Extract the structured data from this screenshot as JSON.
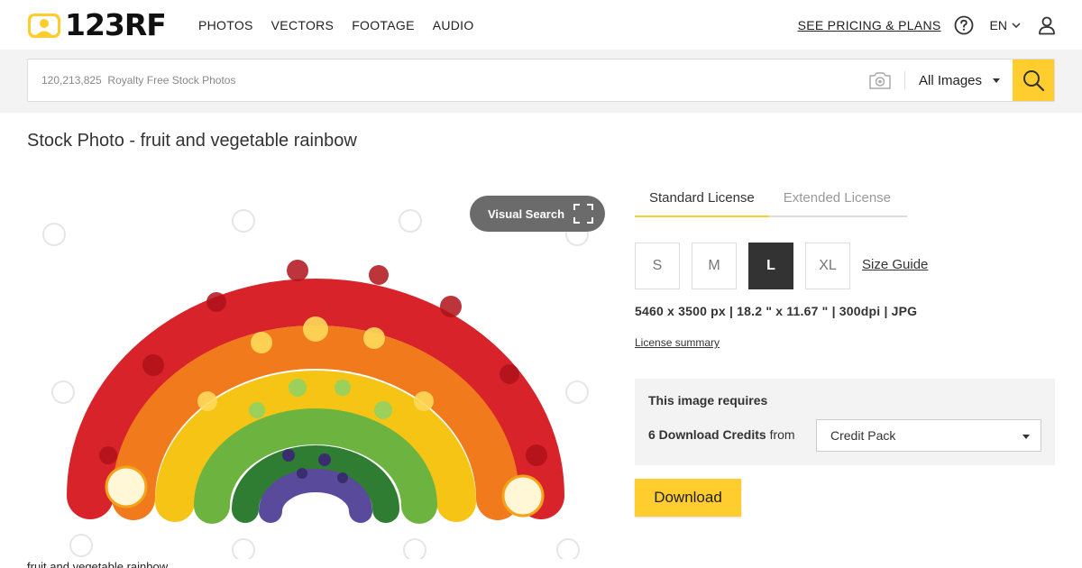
{
  "header": {
    "logo_text": "123RF",
    "nav": [
      "PHOTOS",
      "VECTORS",
      "FOOTAGE",
      "AUDIO"
    ],
    "pricing": "SEE PRICING & PLANS",
    "language": "EN"
  },
  "search": {
    "placeholder": "120,213,825  Royalty Free Stock Photos",
    "filter": "All Images"
  },
  "page": {
    "title": "Stock Photo - fruit and vegetable rainbow",
    "caption": "fruit and vegetable rainbow",
    "visual_search": "Visual Search"
  },
  "license": {
    "tabs": [
      "Standard License",
      "Extended License"
    ],
    "sizes": [
      "S",
      "M",
      "L",
      "XL"
    ],
    "selected_size": "L",
    "size_guide": "Size Guide",
    "specs": "5460 x 3500 px | 18.2 \" x 11.67 \" | 300dpi | JPG",
    "summary_link": "License summary",
    "requires": "This image requires",
    "credits": "6 Download Credits",
    "from": "from",
    "pack": "Credit Pack",
    "download": "Download"
  },
  "colors": {
    "accent": "#ffcd2e",
    "dark": "#333333"
  }
}
